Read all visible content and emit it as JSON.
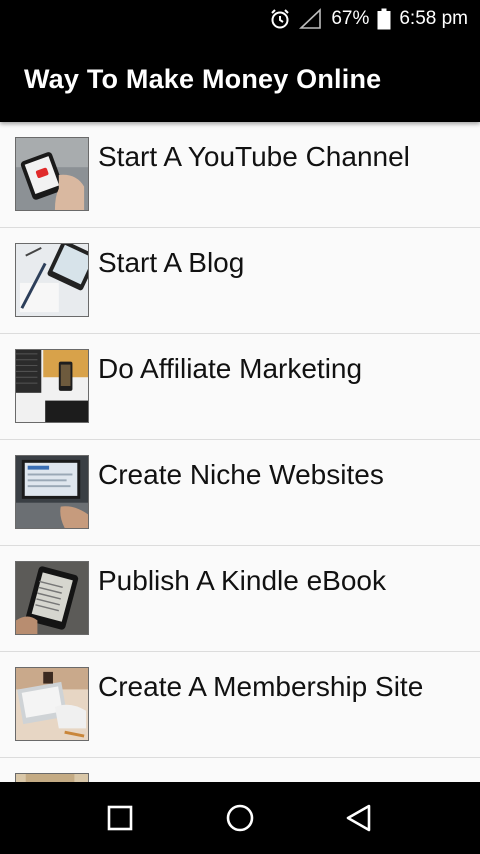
{
  "status_bar": {
    "battery_percent": "67%",
    "time": "6:58 pm",
    "icons": [
      "alarm-icon",
      "signal-icon",
      "battery-icon"
    ]
  },
  "app_bar": {
    "title": "Way To Make Money Online"
  },
  "list": {
    "items": [
      {
        "label": "Start A YouTube Channel",
        "thumbnail": "phone-youtube-thumbnail"
      },
      {
        "label": "Start A Blog",
        "thumbnail": "desk-tablet-thumbnail"
      },
      {
        "label": "Do Affiliate Marketing",
        "thumbnail": "laptop-phone-thumbnail"
      },
      {
        "label": "Create Niche Websites",
        "thumbnail": "laptop-typing-thumbnail"
      },
      {
        "label": "Publish A Kindle eBook",
        "thumbnail": "ereader-thumbnail"
      },
      {
        "label": "Create A Membership Site",
        "thumbnail": "laptop-desk-thumbnail"
      }
    ]
  },
  "nav_bar": {
    "icons": [
      "recents-square-icon",
      "home-circle-icon",
      "back-triangle-icon"
    ]
  }
}
